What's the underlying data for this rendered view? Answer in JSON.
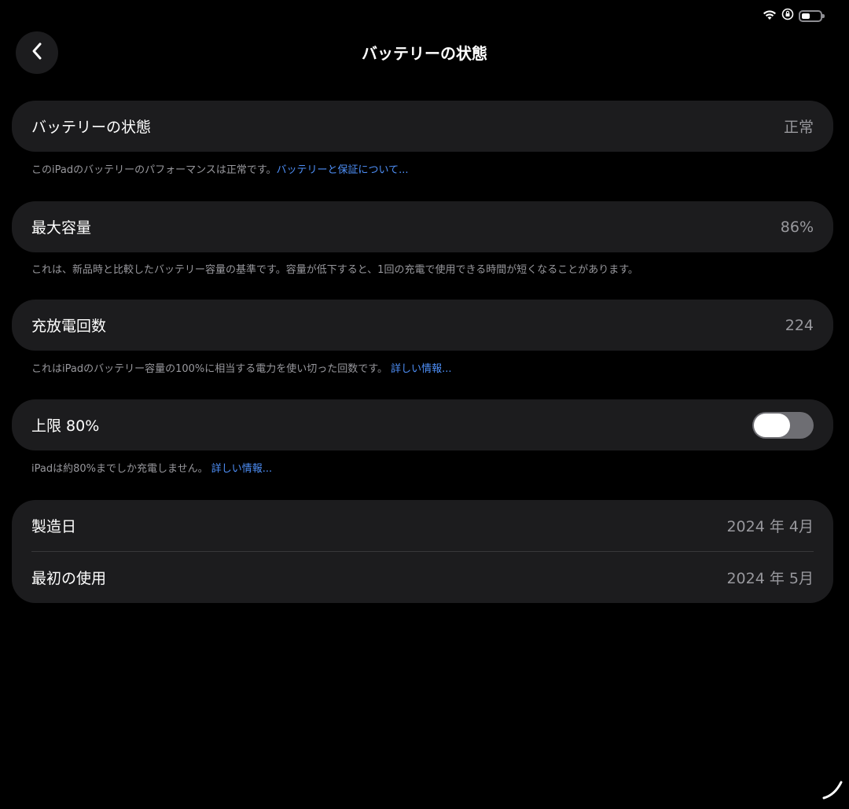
{
  "status_bar": {
    "icons": [
      "wifi-icon",
      "screen-rotation-lock-icon",
      "battery-icon"
    ],
    "battery_level": 0.45
  },
  "header": {
    "back_icon": "chevron-left-icon",
    "title": "バッテリーの状態"
  },
  "battery_health": {
    "label": "バッテリーの状態",
    "value": "正常",
    "footnote": "このiPadのバッテリーのパフォーマンスは正常です。",
    "link": "バッテリーと保証について..."
  },
  "max_capacity": {
    "label": "最大容量",
    "value": "86%",
    "footnote": "これは、新品時と比較したバッテリー容量の基準です。容量が低下すると、1回の充電で使用できる時間が短くなることがあります。"
  },
  "cycle_count": {
    "label": "充放電回数",
    "value": "224",
    "footnote": "これはiPadのバッテリー容量の100%に相当する電力を使い切った回数です。",
    "link": "詳しい情報..."
  },
  "limit": {
    "label": "上限 80%",
    "toggle_on": false,
    "footnote": "iPadは約80%までしか充電しません。",
    "link": "詳しい情報..."
  },
  "dates": {
    "manufacture_label": "製造日",
    "manufacture_value": "2024 年 4月",
    "first_use_label": "最初の使用",
    "first_use_value": "2024 年 5月"
  },
  "colors": {
    "background": "#000000",
    "card": "#1c1c1e",
    "secondary_text": "#98989d",
    "link": "#4e8ff7"
  }
}
